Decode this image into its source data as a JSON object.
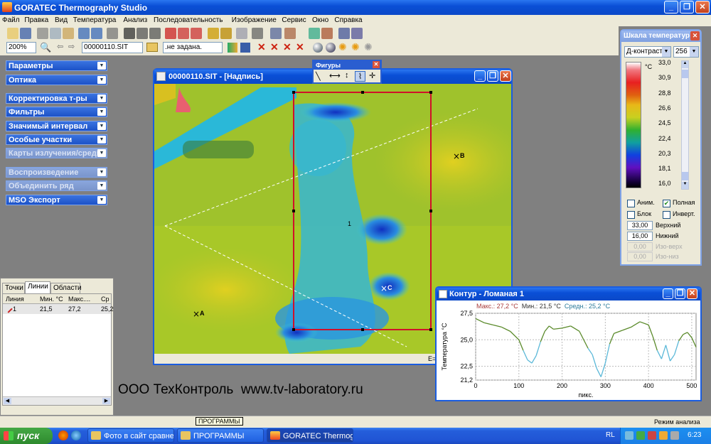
{
  "app": {
    "title": "GORATEC Thermography Studio"
  },
  "menu": [
    "Файл",
    "Правка",
    "Вид",
    "Температура",
    "Анализ",
    "Последовательность",
    "Изображение",
    "Сервис",
    "Окно",
    "Справка"
  ],
  "toolbar2": {
    "zoom": "200%",
    "file": "00000110.SIT",
    "preset": ".не задана."
  },
  "panels": [
    "Параметры",
    "Оптика",
    "Корректировка т-ры",
    "Фильтры",
    "Значимый интервал",
    "Особые участки",
    "Карты излучения/среды",
    "Воспроизведение",
    "Объединить ряд",
    "MSO Экспорт"
  ],
  "tabs": [
    "Точки",
    "Линии",
    "Области"
  ],
  "table": {
    "headers": [
      "Линия",
      "Мин. °С",
      "Макс....",
      "Ср"
    ],
    "rows": [
      [
        "1",
        "21,5",
        "27,2",
        "25,2"
      ]
    ]
  },
  "image_window": {
    "title": "00000110.SIT - [Надпись]",
    "markers": [
      "A",
      "B",
      "C",
      "1"
    ],
    "status": "E="
  },
  "figures": {
    "title": "Фигуры"
  },
  "scale": {
    "title": "Шкала температур",
    "mode": "Д-контраст",
    "levels": "256",
    "unit": "°C",
    "ticks": [
      "33,0",
      "30,9",
      "28,8",
      "26,6",
      "24,5",
      "22,4",
      "20,3",
      "18,1",
      "16,0"
    ],
    "anim": "Аним.",
    "full": "Полная",
    "block": "Блок",
    "invert": "Инверт.",
    "upper_value": "33,00",
    "upper_label": "Верхний",
    "lower_value": "16,00",
    "lower_label": "Нижний",
    "iso_up_value": "0,00",
    "iso_up_label": "Изо-верх",
    "iso_down_value": "0,00",
    "iso_down_label": "Изо-низ"
  },
  "contour": {
    "title": "Контур - Ломаная 1",
    "max_label": "Макс.: 27,2 °C",
    "min_label": "Мин.: 21,5 °C",
    "avg_label": "Средн.: 25,2 °C"
  },
  "chart_data": {
    "type": "line",
    "ylabel": "Температура °С",
    "xlabel": "пикс.",
    "ylim": [
      21.2,
      27.5
    ],
    "xlim": [
      0,
      510
    ],
    "yticks": [
      21.2,
      22.5,
      25.0,
      27.5
    ],
    "xticks": [
      0,
      100,
      200,
      300,
      400,
      500
    ],
    "x": [
      0,
      20,
      40,
      60,
      80,
      100,
      110,
      120,
      130,
      140,
      150,
      160,
      170,
      180,
      200,
      220,
      240,
      260,
      270,
      280,
      290,
      300,
      310,
      320,
      340,
      360,
      380,
      400,
      410,
      420,
      430,
      440,
      450,
      460,
      470,
      480,
      490,
      500,
      510
    ],
    "values": [
      27.0,
      26.6,
      26.4,
      26.2,
      25.8,
      25.0,
      24.0,
      23.1,
      22.8,
      23.5,
      24.8,
      25.8,
      26.3,
      26.0,
      26.1,
      26.3,
      25.8,
      24.2,
      23.6,
      22.3,
      21.5,
      22.8,
      24.6,
      25.6,
      25.9,
      26.2,
      26.7,
      26.4,
      25.3,
      24.0,
      23.2,
      24.5,
      23.0,
      23.6,
      24.9,
      25.5,
      25.7,
      25.2,
      24.3
    ],
    "colors": [
      "#5a8a2a",
      "#5ab8d8"
    ]
  },
  "watermark": "ООО ТехКонтроль  www.tv-laboratory.ru",
  "status": {
    "tooltip": "ПРОГРАММЫ",
    "mode": "Режим анализа"
  },
  "taskbar": {
    "start": "пуск",
    "items": [
      "Фото в сайт сравне...",
      "ПРОГРАММЫ",
      "GORATEC Thermogra..."
    ],
    "lang": "RL",
    "time": "6:23"
  }
}
